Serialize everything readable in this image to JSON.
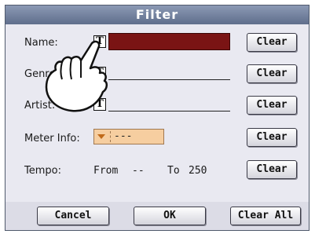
{
  "dialog": {
    "title": "Filter"
  },
  "rows": {
    "name": {
      "label": "Name:",
      "clear": "Clear"
    },
    "genre": {
      "label": "Genre:",
      "clear": "Clear"
    },
    "artist": {
      "label": "Artist:",
      "clear": "Clear"
    },
    "meter": {
      "label": "Meter Info:",
      "value": "---",
      "clear": "Clear"
    },
    "tempo": {
      "label": "Tempo:",
      "from_label": "From",
      "from_value": "--",
      "to_label": "To",
      "to_value": "250",
      "clear": "Clear"
    }
  },
  "text_icon": "T",
  "footer": {
    "cancel": "Cancel",
    "ok": "OK",
    "clear_all": "Clear All"
  },
  "colors": {
    "title_bar": "#6f7e9c",
    "active_field": "#7a1414",
    "meter_box": "#f6cea0"
  },
  "icons": [
    "text-edit-icon",
    "dropdown-arrow-icon",
    "pointing-hand-icon"
  ]
}
